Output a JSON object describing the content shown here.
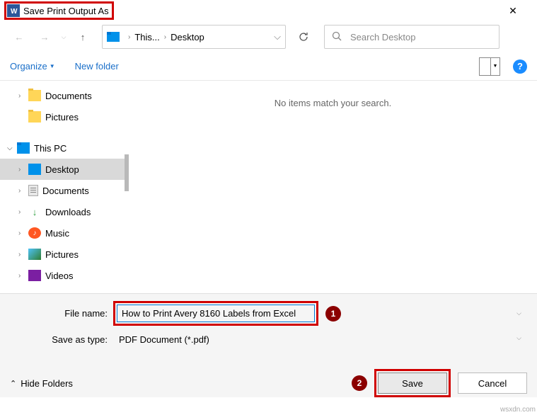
{
  "title": "Save Print Output As",
  "breadcrumb": {
    "part1": "This...",
    "part2": "Desktop"
  },
  "search": {
    "placeholder": "Search Desktop"
  },
  "toolbar": {
    "organize": "Organize",
    "newfolder": "New folder"
  },
  "tree": {
    "quick": [
      {
        "label": "Documents"
      },
      {
        "label": "Pictures"
      }
    ],
    "thispc_label": "This PC",
    "items": [
      {
        "label": "Desktop"
      },
      {
        "label": "Documents"
      },
      {
        "label": "Downloads"
      },
      {
        "label": "Music"
      },
      {
        "label": "Pictures"
      },
      {
        "label": "Videos"
      }
    ]
  },
  "main": {
    "empty": "No items match your search."
  },
  "form": {
    "filename_label": "File name:",
    "filename_value": "How to Print Avery 8160 Labels from Excel",
    "savetype_label": "Save as type:",
    "savetype_value": "PDF Document (*.pdf)"
  },
  "footer": {
    "hide": "Hide Folders",
    "save": "Save",
    "cancel": "Cancel"
  },
  "markers": {
    "one": "1",
    "two": "2"
  },
  "watermark": "wsxdn.com"
}
